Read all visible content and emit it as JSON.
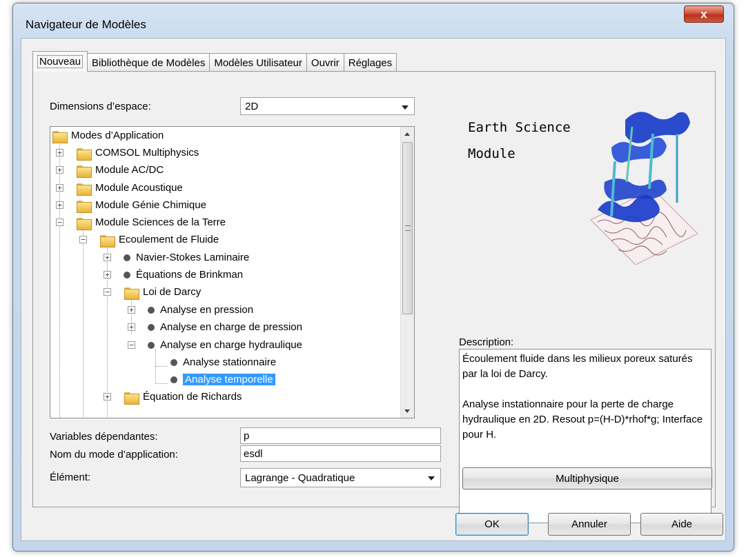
{
  "window": {
    "title": "Navigateur de Modèles",
    "close_label": "x"
  },
  "tabs": [
    {
      "label": "Nouveau"
    },
    {
      "label": "Bibliothèque de Modèles"
    },
    {
      "label": "Modèles Utilisateur"
    },
    {
      "label": "Ouvrir"
    },
    {
      "label": "Réglages"
    }
  ],
  "space_dimension": {
    "label": "Dimensions d’espace:",
    "value": "2D"
  },
  "tree": {
    "items": [
      {
        "label": "Modes d’Application",
        "kind": "folder"
      },
      {
        "label": "COMSOL Multiphysics",
        "kind": "folder"
      },
      {
        "label": "Module AC/DC",
        "kind": "folder"
      },
      {
        "label": "Module Acoustique",
        "kind": "folder"
      },
      {
        "label": "Module Génie Chimique",
        "kind": "folder"
      },
      {
        "label": "Module Sciences de la Terre",
        "kind": "folder"
      },
      {
        "label": "Ecoulement de Fluide",
        "kind": "folder"
      },
      {
        "label": "Navier-Stokes Laminaire",
        "kind": "bullet"
      },
      {
        "label": "Équations de Brinkman",
        "kind": "bullet"
      },
      {
        "label": "Loi de Darcy",
        "kind": "folder"
      },
      {
        "label": "Analyse en pression",
        "kind": "bullet"
      },
      {
        "label": "Analyse en charge de pression",
        "kind": "bullet"
      },
      {
        "label": "Analyse en charge hydraulique",
        "kind": "bullet"
      },
      {
        "label": "Analyse stationnaire",
        "kind": "bullet"
      },
      {
        "label": "Analyse temporelle",
        "kind": "bullet",
        "selected": true
      },
      {
        "label": "Équation de Richards",
        "kind": "folder"
      }
    ]
  },
  "dependent_variables": {
    "label": "Variables dépendantes:",
    "value": "p"
  },
  "application_mode_name": {
    "label": "Nom du mode d’application:",
    "value": "esdl"
  },
  "element": {
    "label": "Élément:",
    "value": "Lagrange - Quadratique"
  },
  "preview": {
    "title_line1": "Earth Science",
    "title_line2": "Module"
  },
  "description": {
    "label": "Description:",
    "paragraph1": "Écoulement fluide dans les milieux poreux saturés par la loi de Darcy.",
    "paragraph2": "Analyse instationnaire pour la perte de charge hydraulique en 2D. Resout p=(H-D)*rhof*g; Interface pour H."
  },
  "buttons": {
    "multiphysics": "Multiphysique",
    "ok": "OK",
    "cancel": "Annuler",
    "help": "Aide"
  },
  "colors": {
    "selection": "#3399ff",
    "title_gradient": "#c7d9ed",
    "close_button": "#c8452e"
  }
}
